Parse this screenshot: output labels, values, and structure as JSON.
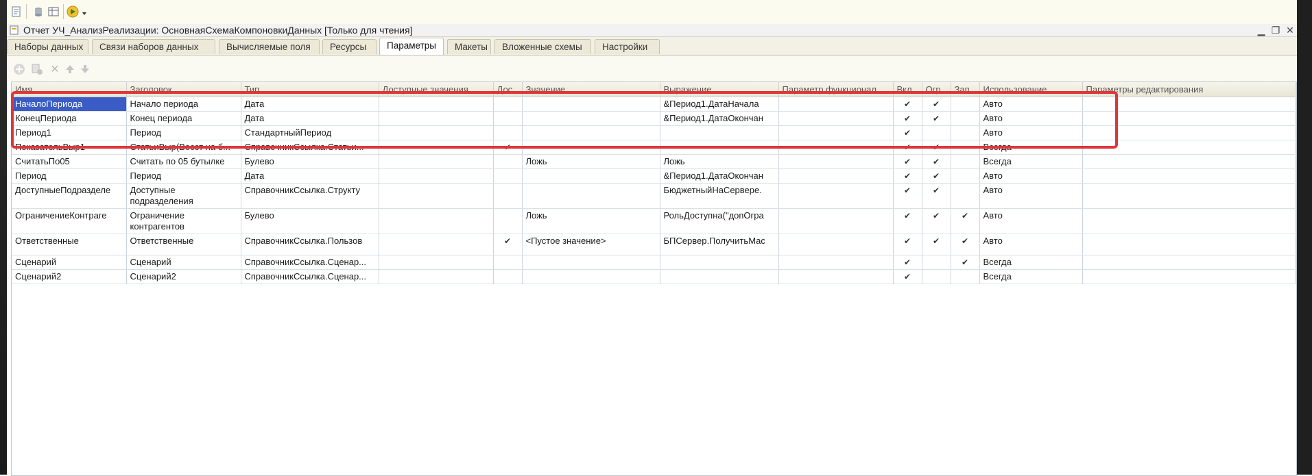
{
  "window": {
    "title": "Отчет УЧ_АнализРеализации: ОсновнаяСхемаКомпоновкиДанных [Только для чтения]"
  },
  "tabs": [
    {
      "label": "Наборы данных"
    },
    {
      "label": "Связи наборов данных"
    },
    {
      "label": "Вычисляемые поля"
    },
    {
      "label": "Ресурсы"
    },
    {
      "label": "Параметры"
    },
    {
      "label": "Макеты"
    },
    {
      "label": "Вложенные схемы"
    },
    {
      "label": "Настройки"
    }
  ],
  "grid": {
    "columns": [
      "Имя",
      "Заголовок",
      "Тип",
      "Доступные значения",
      "Дос.",
      "Значение",
      "Выражение",
      "Параметр функционал.",
      "Вкл.",
      "Огр.",
      "Зап.",
      "Использование",
      "Параметры редактирования"
    ],
    "rows": [
      {
        "name": "НачалоПериода",
        "title": "Начало периода",
        "type": "Дата",
        "avail": "",
        "dos": false,
        "value": "",
        "expr": "&Период1.ДатаНачала",
        "func": "",
        "vkl": true,
        "ogr": true,
        "zap": false,
        "use": "Авто",
        "edit": ""
      },
      {
        "name": "КонецПериода",
        "title": "Конец периода",
        "type": "Дата",
        "avail": "",
        "dos": false,
        "value": "",
        "expr": "&Период1.ДатаОкончан",
        "func": "",
        "vkl": true,
        "ogr": true,
        "zap": false,
        "use": "Авто",
        "edit": ""
      },
      {
        "name": "Период1",
        "title": "Период",
        "type": "СтандартныйПериод",
        "avail": "",
        "dos": false,
        "value": "",
        "expr": "",
        "func": "",
        "vkl": true,
        "ogr": false,
        "zap": false,
        "use": "Авто",
        "edit": ""
      },
      {
        "name": "ПоказательВыр1",
        "title": "СтатьиВыр(Восст на б...",
        "type": "СправочникСсылка.Статьи...",
        "avail": "",
        "dos": true,
        "value": "",
        "expr": "",
        "func": "",
        "vkl": true,
        "ogr": true,
        "zap": false,
        "use": "Всегда",
        "edit": ""
      },
      {
        "name": "СчитатьПо05",
        "title": "Считать по 05 бутылке",
        "type": "Булево",
        "avail": "",
        "dos": false,
        "value": "Ложь",
        "expr": "Ложь",
        "func": "",
        "vkl": true,
        "ogr": true,
        "zap": false,
        "use": "Всегда",
        "edit": ""
      },
      {
        "name": "Период",
        "title": "Период",
        "type": "Дата",
        "avail": "",
        "dos": false,
        "value": "",
        "expr": "&Период1.ДатаОкончан",
        "func": "",
        "vkl": true,
        "ogr": true,
        "zap": false,
        "use": "Авто",
        "edit": ""
      },
      {
        "name": "ДоступныеПодразделе",
        "title": "Доступные подразделения",
        "type": "СправочникСсылка.Структу",
        "avail": "",
        "dos": false,
        "value": "",
        "expr": "БюджетныйНаСервере.",
        "func": "",
        "vkl": true,
        "ogr": true,
        "zap": false,
        "use": "Авто",
        "edit": ""
      },
      {
        "name": "ОграничениеКонтраге",
        "title": "Ограничение контрагентов",
        "type": "Булево",
        "avail": "",
        "dos": false,
        "value": "Ложь",
        "expr": "РольДоступна(\"допОгра",
        "func": "",
        "vkl": true,
        "ogr": true,
        "zap": true,
        "use": "Авто",
        "edit": ""
      },
      {
        "name": "Ответственные",
        "title": "Ответственные",
        "type": "СправочникСсылка.Пользов",
        "avail": "",
        "dos": true,
        "value": "<Пустое значение>",
        "expr": "БПСервер.ПолучитьМас",
        "func": "",
        "vkl": true,
        "ogr": true,
        "zap": true,
        "use": "Авто",
        "edit": ""
      },
      {
        "name": "Сценарий",
        "title": "Сценарий",
        "type": "СправочникСсылка.Сценар...",
        "avail": "",
        "dos": false,
        "value": "",
        "expr": "",
        "func": "",
        "vkl": true,
        "ogr": false,
        "zap": true,
        "use": "Всегда",
        "edit": ""
      },
      {
        "name": "Сценарий2",
        "title": "Сценарий2",
        "type": "СправочникСсылка.Сценар...",
        "avail": "",
        "dos": false,
        "value": "",
        "expr": "",
        "func": "",
        "vkl": true,
        "ogr": false,
        "zap": false,
        "use": "Всегда",
        "edit": ""
      }
    ]
  },
  "colors": {
    "selection": "#3a5cc4",
    "highlight": "#e0353a"
  }
}
